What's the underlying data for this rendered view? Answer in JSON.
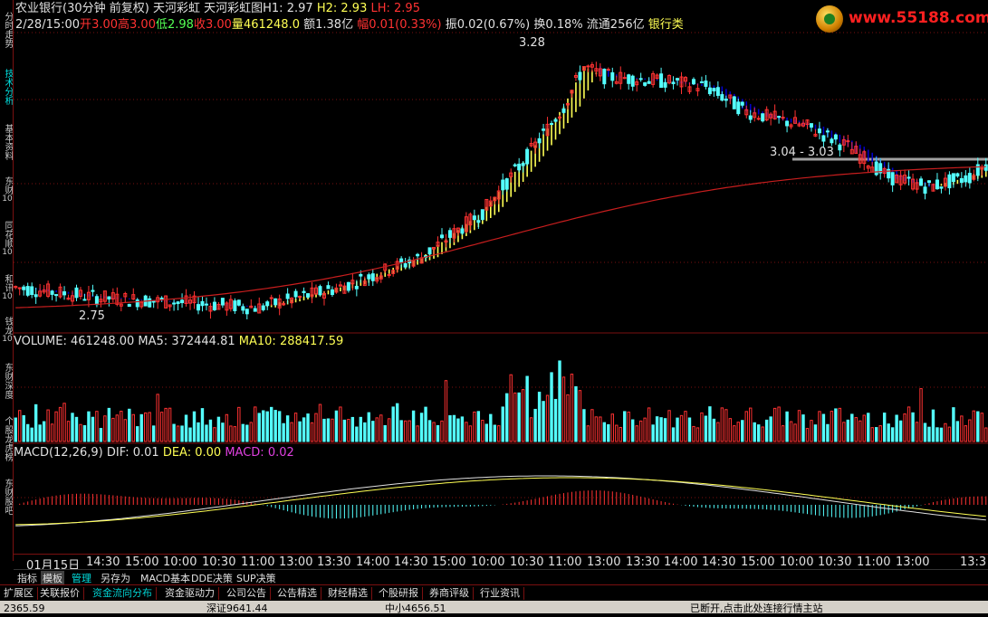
{
  "header": {
    "stock": "农业银行(30分钟 前复权)",
    "indicator": "天河彩虹",
    "indicator2": "天河彩虹图",
    "h1_label": "H1:",
    "h1": "2.97",
    "h2_label": "H2:",
    "h2": "2.93",
    "lh_label": "LH:",
    "lh": "2.95"
  },
  "quote": {
    "datetime": "2/28/15:00",
    "open_label": "开",
    "open": "3.00",
    "high_label": "高",
    "high": "3.00",
    "low_label": "低",
    "low": "2.98",
    "close_label": "收",
    "close": "3.00",
    "vol_label": "量",
    "vol": "461248.0",
    "amount_label": "额",
    "amount": "1.38亿",
    "chg_label": "幅",
    "chg": "0.01(0.33%)",
    "amp_label": "振",
    "amp": "0.02(0.67%)",
    "turn_label": "换",
    "turn": "0.18%",
    "float_label": "流通",
    "float": "256亿",
    "sector": "银行类"
  },
  "annotations": {
    "max": "3.28",
    "min": "2.75",
    "range": "3.04 - 3.03"
  },
  "volume_bar": {
    "label": "VOLUME:",
    "value": "461248.00",
    "ma5_label": "MA5:",
    "ma5": "372444.81",
    "ma10_label": "MA10:",
    "ma10": "288417.59"
  },
  "macd_bar": {
    "label": "MACD(12,26,9)",
    "dif_label": "DIF:",
    "dif": "0.01",
    "dea_label": "DEA:",
    "dea": "0.00",
    "macd_label": "MACD:",
    "macd": "0.02"
  },
  "side_tabs": [
    {
      "label": "分时走势"
    },
    {
      "label": "技术分析"
    },
    {
      "label": "基本资料"
    },
    {
      "label": "东财",
      "num": "10"
    },
    {
      "label": "同花顺",
      "num": "10"
    },
    {
      "label": "和讯",
      "num": "10"
    },
    {
      "label": "钱龙",
      "num": "10"
    },
    {
      "label": "东财深度"
    },
    {
      "label": "个股龙虎榜"
    },
    {
      "label": "东财股吧"
    }
  ],
  "time_labels": [
    "01月15日",
    "14:30",
    "15:00",
    "10:00",
    "10:30",
    "11:00",
    "13:00",
    "13:30",
    "14:00",
    "14:30",
    "15:00",
    "10:00",
    "10:30",
    "11:00",
    "13:00",
    "13:30",
    "14:00",
    "14:30",
    "15:00",
    "10:00",
    "10:30",
    "11:00",
    "13:00",
    "13:3"
  ],
  "tabs1": [
    "指标",
    "模板",
    "管理",
    "另存为",
    "MACD基本",
    "DDE决策",
    "SUP决策"
  ],
  "tabs2": [
    "扩展区",
    "关联报价",
    "资金流向分布",
    "资金驱动力",
    "公司公告",
    "公告精选",
    "财经精选",
    "个股研报",
    "券商评级",
    "行业资讯"
  ],
  "status": {
    "s1": "2365.59",
    "s2": "深证9641.44",
    "s3": "中小4656.51",
    "s4": "已断开,点击此处连接行情主站"
  },
  "logo": {
    "url": "www.55188.com"
  },
  "colors": {
    "up": "#ff3232",
    "down": "#54ffff",
    "yellow": "#ffff54",
    "blue": "#0000c8",
    "ma": "#c81e1e",
    "grid": "#7a1010"
  }
}
